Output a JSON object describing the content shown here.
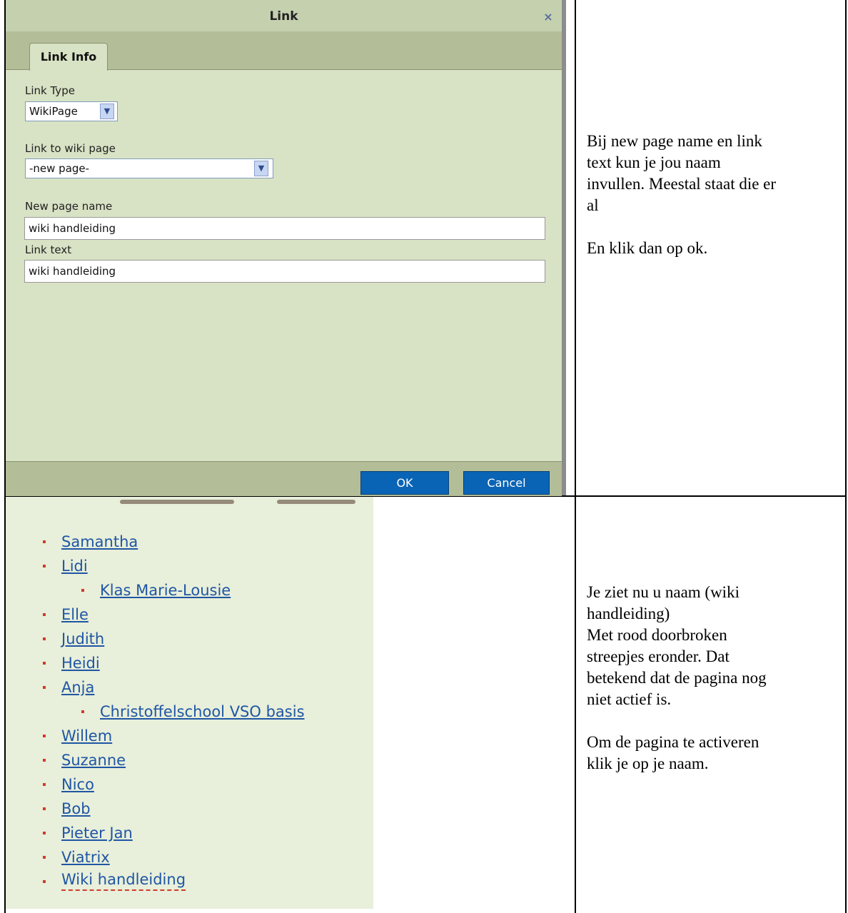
{
  "dialog": {
    "title": "Link",
    "close_glyph": "×",
    "tab_label": "Link Info",
    "link_type_label": "Link Type",
    "link_type_value": "WikiPage",
    "link_to_label": "Link to wiki page",
    "link_to_value": "-new page-",
    "new_page_name_label": "New page name",
    "new_page_name_value": "wiki handleiding",
    "link_text_label": "Link text",
    "link_text_value": "wiki handleiding",
    "ok_label": "OK",
    "cancel_label": "Cancel",
    "dropdown_icon": "chevron-down-icon"
  },
  "note1": {
    "line1": "Bij new page name en link",
    "line2": "text kun je jou naam",
    "line3": "invullen. Meestal staat die er",
    "line4": "al",
    "line5": "En klik dan op ok."
  },
  "wiki_list": {
    "items": [
      {
        "label": "Samantha",
        "level": 1
      },
      {
        "label": "Lidi",
        "level": 1
      },
      {
        "label": "Klas Marie-Lousie",
        "level": 2
      },
      {
        "label": "Elle",
        "level": 1
      },
      {
        "label": "Judith",
        "level": 1
      },
      {
        "label": "Heidi",
        "level": 1
      },
      {
        "label": "Anja",
        "level": 1
      },
      {
        "label": "Christoffelschool VSO basis",
        "level": 2
      },
      {
        "label": "Willem",
        "level": 1
      },
      {
        "label": "Suzanne",
        "level": 1
      },
      {
        "label": "Nico",
        "level": 1
      },
      {
        "label": "Bob",
        "level": 1
      },
      {
        "label": "Pieter Jan",
        "level": 1
      },
      {
        "label": "Viatrix",
        "level": 1
      },
      {
        "label": "Wiki handleiding",
        "level": 1,
        "state": "new-page"
      }
    ],
    "colors": {
      "link": "#1f56a4",
      "bullet": "#d13b2a",
      "new_page_underline": "#d13b2a"
    }
  },
  "note2": {
    "line1": "Je ziet nu u naam (wiki",
    "line2": "handleiding)",
    "line3": "Met rood doorbroken",
    "line4": "streepjes eronder. Dat",
    "line5": "betekend dat de pagina nog",
    "line6": "niet actief is.",
    "line7": "Om de pagina te activeren",
    "line8": "klik je op je naam."
  }
}
